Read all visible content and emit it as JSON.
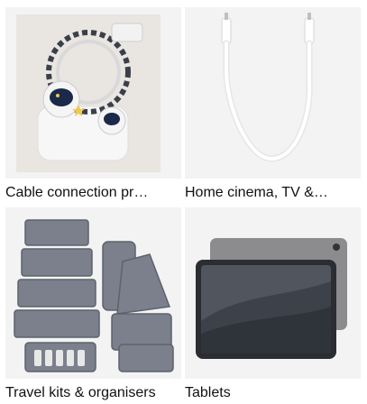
{
  "tiles": [
    {
      "label": "Cable connection pr…",
      "image": "cable-protector-image"
    },
    {
      "label": "Home cinema, TV &…",
      "image": "usb-c-cable-image"
    },
    {
      "label": "Travel kits & organisers",
      "image": "packing-cubes-image"
    },
    {
      "label": "Tablets",
      "image": "tablet-image"
    }
  ]
}
